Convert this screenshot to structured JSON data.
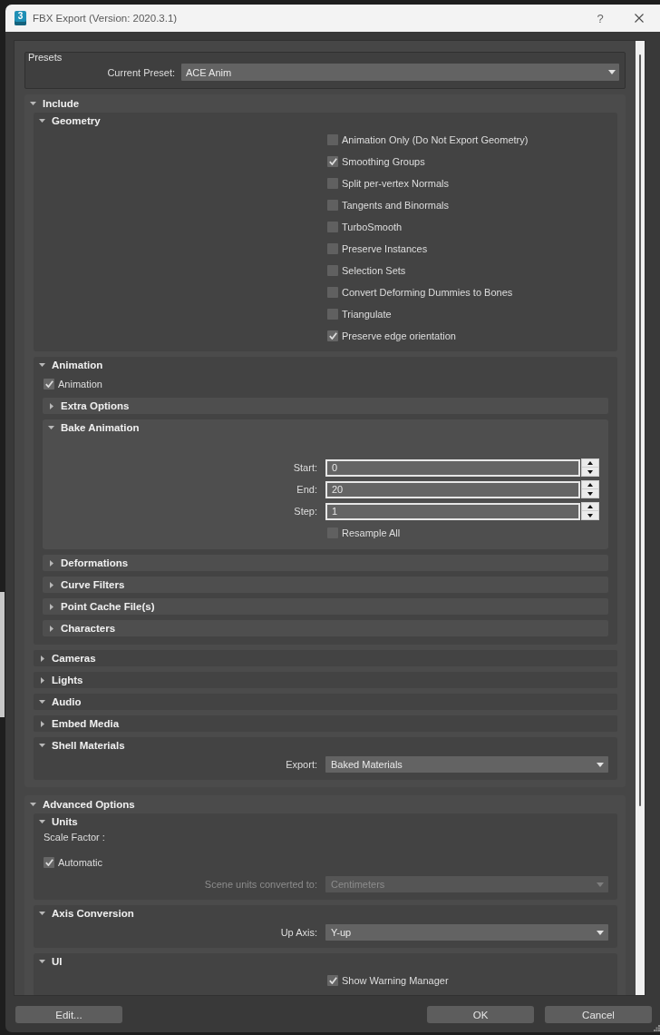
{
  "window": {
    "logo": "3",
    "title": "FBX Export (Version: 2020.3.1)",
    "help": "?"
  },
  "presets": {
    "title": "Presets",
    "label": "Current Preset:",
    "value": "ACE Anim"
  },
  "rollouts": [
    {
      "title": "Include",
      "expanded": true,
      "children": [
        {
          "kind": "rollout",
          "title": "Geometry",
          "expanded": true,
          "children": [
            {
              "kind": "checkbox",
              "label": "Animation Only (Do Not Export Geometry)",
              "checked": false
            },
            {
              "kind": "checkbox",
              "label": "Smoothing Groups",
              "checked": true
            },
            {
              "kind": "checkbox",
              "label": "Split per-vertex Normals",
              "checked": false
            },
            {
              "kind": "checkbox",
              "label": "Tangents and Binormals",
              "checked": false
            },
            {
              "kind": "checkbox",
              "label": "TurboSmooth",
              "checked": false
            },
            {
              "kind": "checkbox",
              "label": "Preserve Instances",
              "checked": false
            },
            {
              "kind": "checkbox",
              "label": "Selection Sets",
              "checked": false
            },
            {
              "kind": "checkbox",
              "label": "Convert Deforming Dummies to Bones",
              "checked": false
            },
            {
              "kind": "checkbox",
              "label": "Triangulate",
              "checked": false
            },
            {
              "kind": "checkbox",
              "label": "Preserve edge orientation",
              "checked": true
            }
          ]
        },
        {
          "kind": "rollout",
          "title": "Animation",
          "expanded": true,
          "children": [
            {
              "kind": "toggle",
              "label": "Animation",
              "checked": true
            },
            {
              "kind": "rollout",
              "title": "Extra Options",
              "expanded": false
            },
            {
              "kind": "rollout",
              "title": "Bake Animation",
              "expanded": true,
              "children": [
                {
                  "kind": "spinner",
                  "label": "Start:",
                  "value": "0"
                },
                {
                  "kind": "spinner",
                  "label": "End:",
                  "value": "20"
                },
                {
                  "kind": "spinner",
                  "label": "Step:",
                  "value": "1"
                },
                {
                  "kind": "checkbox",
                  "label": "Resample All",
                  "checked": false
                }
              ]
            },
            {
              "kind": "rollout",
              "title": "Deformations",
              "expanded": false
            },
            {
              "kind": "rollout",
              "title": "Curve Filters",
              "expanded": false
            },
            {
              "kind": "rollout",
              "title": "Point Cache File(s)",
              "expanded": false
            },
            {
              "kind": "rollout",
              "title": "Characters",
              "expanded": false
            }
          ]
        },
        {
          "kind": "rollout",
          "title": "Cameras",
          "expanded": false
        },
        {
          "kind": "rollout",
          "title": "Lights",
          "expanded": false
        },
        {
          "kind": "rollout",
          "title": "Audio",
          "expanded": true
        },
        {
          "kind": "rollout",
          "title": "Embed Media",
          "expanded": false
        },
        {
          "kind": "rollout",
          "title": "Shell Materials",
          "expanded": true,
          "children": [
            {
              "kind": "dropdown",
              "label": "Export:",
              "value": "Baked Materials",
              "disabled": false
            }
          ]
        }
      ]
    },
    {
      "title": "Advanced Options",
      "expanded": true,
      "children": [
        {
          "kind": "rollout",
          "title": "Units",
          "expanded": true,
          "children": [
            {
              "kind": "text",
              "text": "Scale Factor :"
            },
            {
              "kind": "toggle",
              "label": "Automatic",
              "checked": true
            },
            {
              "kind": "dropdown",
              "label": "Scene units converted to:",
              "value": "Centimeters",
              "disabled": true
            }
          ]
        },
        {
          "kind": "rollout",
          "title": "Axis Conversion",
          "expanded": true,
          "children": [
            {
              "kind": "dropdown",
              "label": "Up Axis:",
              "value": "Y-up",
              "disabled": false
            }
          ]
        },
        {
          "kind": "rollout",
          "title": "UI",
          "expanded": true,
          "children": [
            {
              "kind": "checkbox",
              "label": "Show Warning Manager",
              "checked": true
            }
          ]
        }
      ]
    }
  ],
  "buttons": [
    {
      "label": "Edit..."
    },
    {
      "label": "OK"
    },
    {
      "label": "Cancel"
    }
  ]
}
